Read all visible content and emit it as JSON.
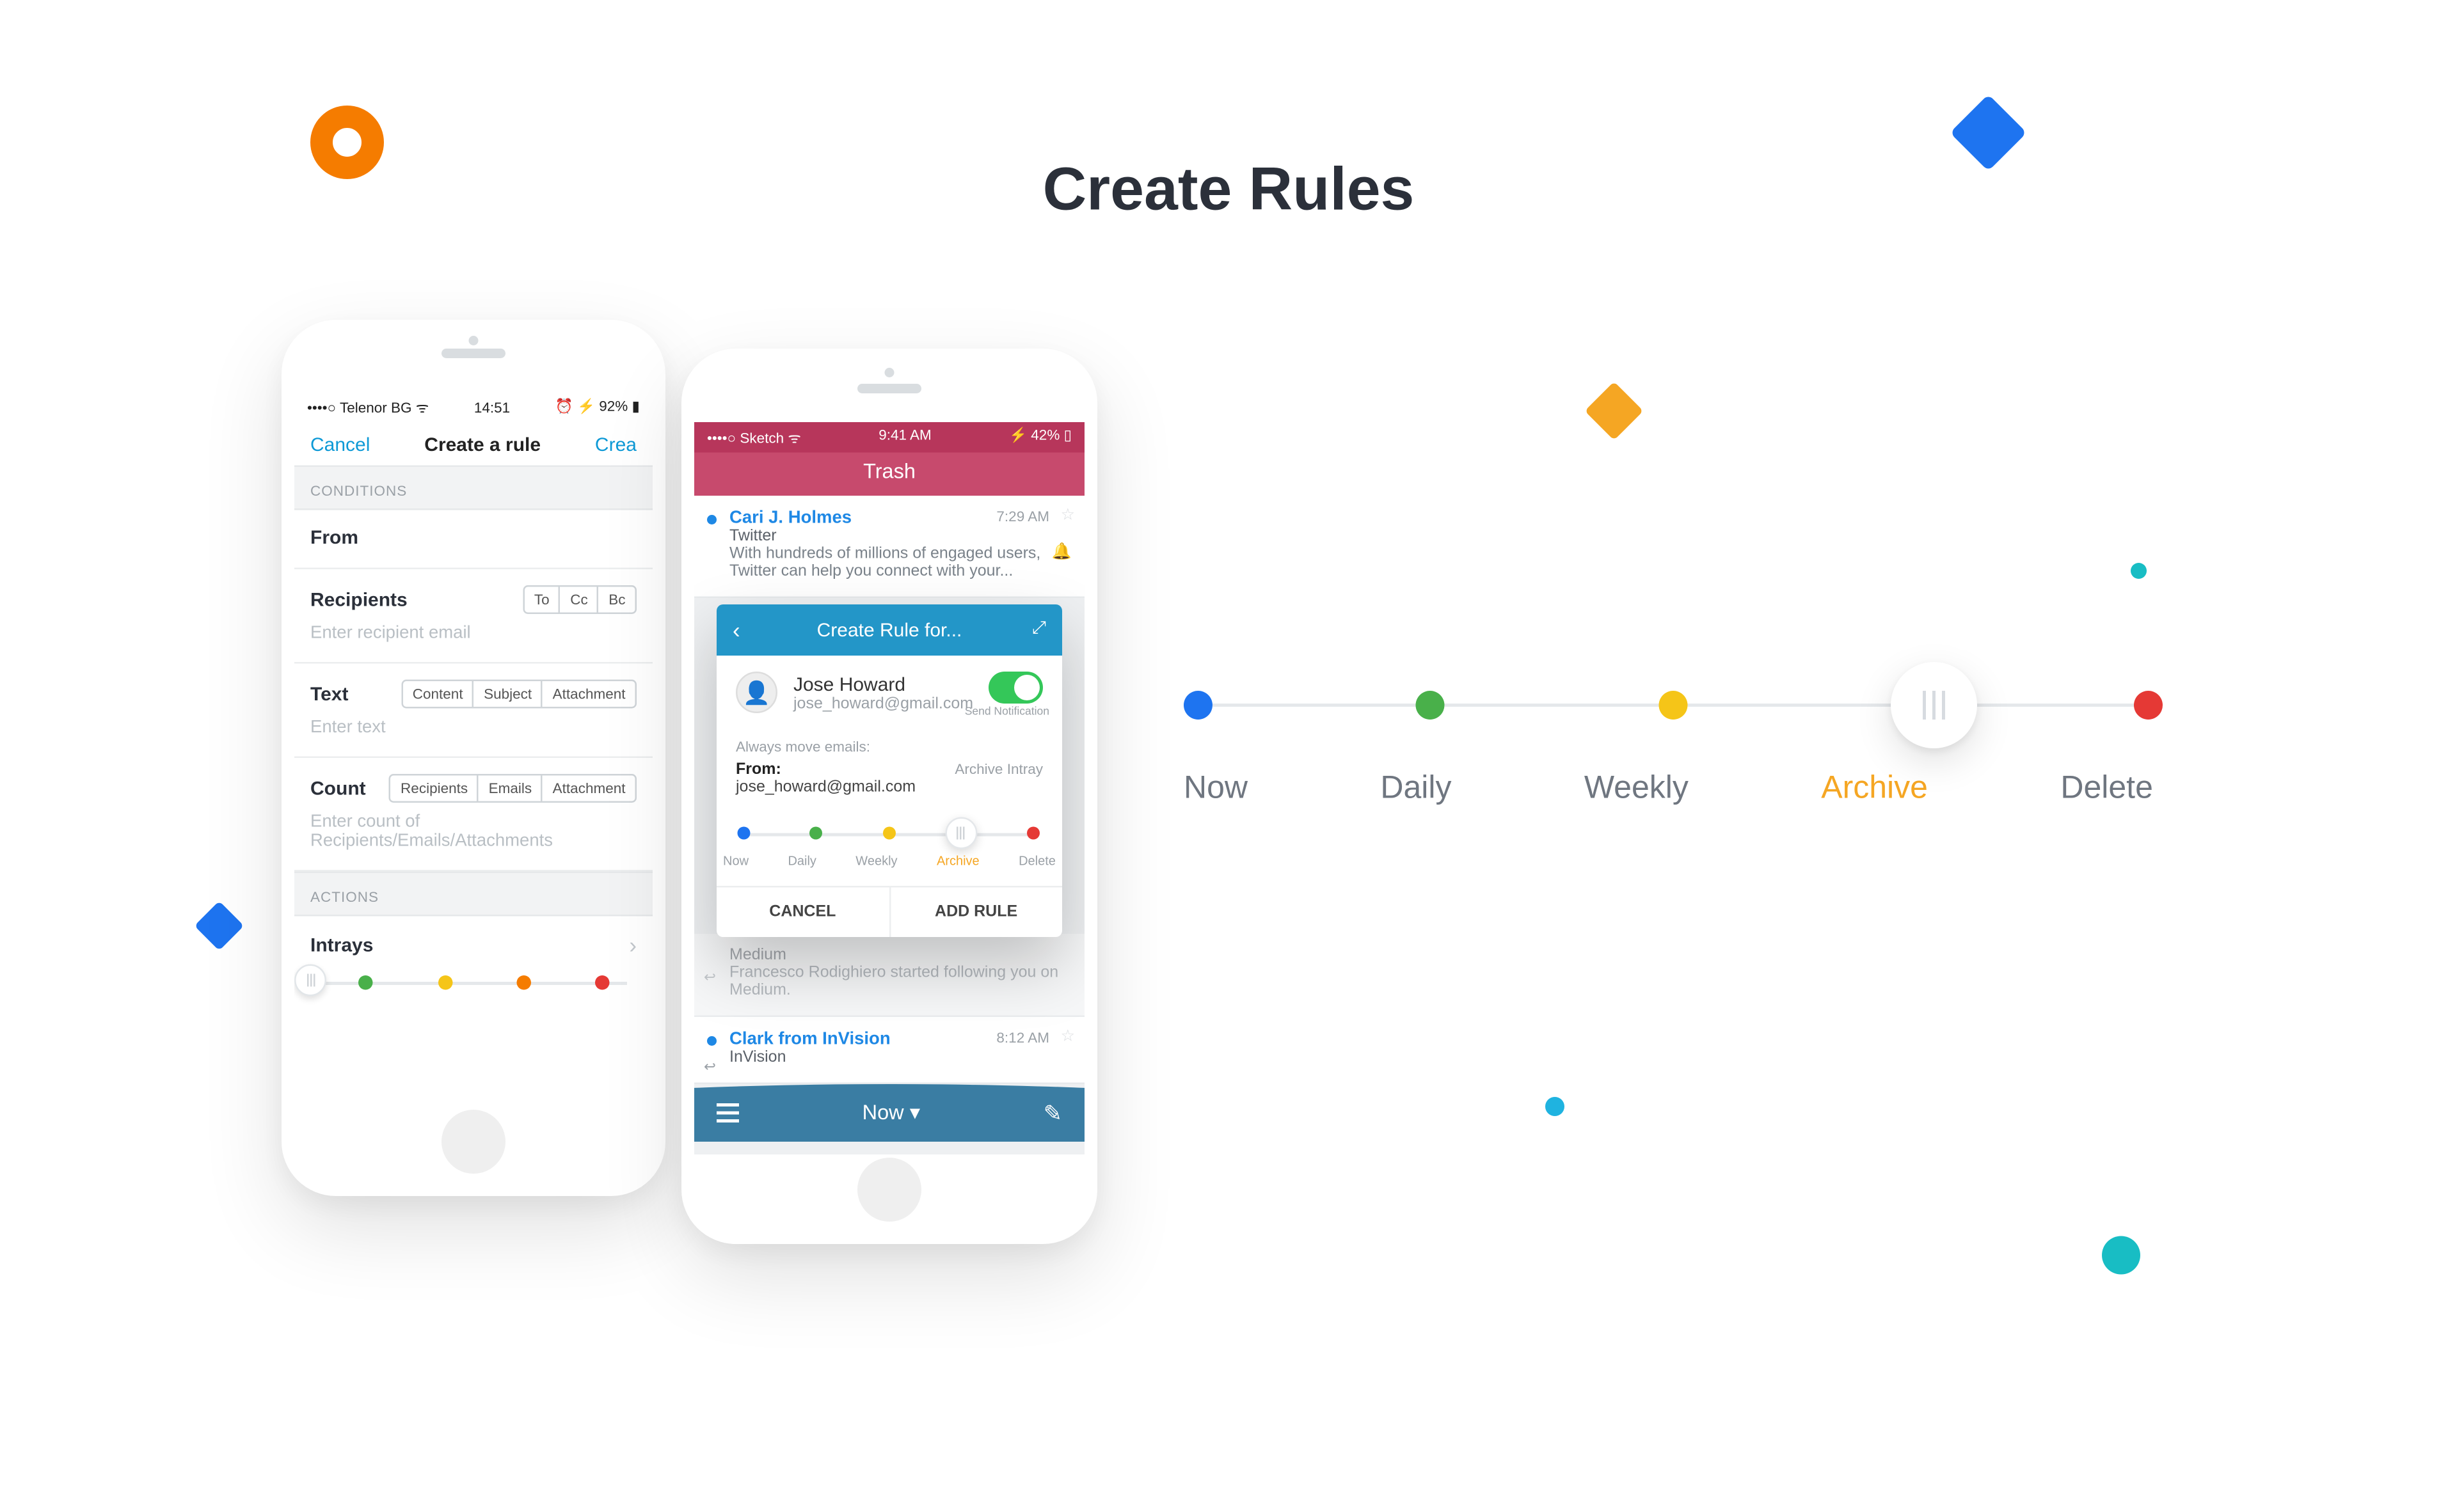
{
  "title": "Create Rules",
  "phone1": {
    "status": {
      "carrier": "••••○ Telenor BG ᯤ",
      "time": "14:51",
      "right": "⏰ ⚡ 92% ▮"
    },
    "nav": {
      "cancel": "Cancel",
      "title": "Create a rule",
      "create": "Crea"
    },
    "sections": {
      "conditions": "CONDITIONS",
      "actions": "ACTIONS"
    },
    "fields": {
      "from": {
        "label": "From"
      },
      "recipients": {
        "label": "Recipients",
        "segs": [
          "To",
          "Cc",
          "Bc"
        ],
        "placeholder": "Enter recipient email"
      },
      "text": {
        "label": "Text",
        "segs": [
          "Content",
          "Subject",
          "Attachment"
        ],
        "placeholder": "Enter text"
      },
      "count": {
        "label": "Count",
        "segs": [
          "Recipients",
          "Emails",
          "Attachment"
        ],
        "placeholder": "Enter count of Recipients/Emails/Attachments"
      },
      "intrays": {
        "label": "Intrays"
      }
    }
  },
  "phone2": {
    "status": {
      "left": "••••○ Sketch ᯤ",
      "time": "9:41 AM",
      "right": "⚡ 42% ▯"
    },
    "title": "Trash",
    "emails": [
      {
        "sender": "Cari J. Holmes",
        "subject": "Twitter",
        "preview": "With hundreds of millions of engaged users, Twitter can help you connect with your...",
        "time": "7:29  AM",
        "unread": true,
        "bell": true
      },
      {
        "sender": "",
        "subject": "Medium",
        "preview": "Francesco Rodighiero started following you on Medium.",
        "time": "",
        "unread": false,
        "reply": true
      },
      {
        "sender": "Clark from InVision",
        "subject": "InVision",
        "preview": "",
        "time": "8:12  AM",
        "unread": true,
        "reply": true
      }
    ],
    "bottombar": {
      "label": "Now"
    },
    "modal": {
      "title": "Create Rule for...",
      "user": {
        "name": "Jose Howard",
        "email": "jose_howard@gmail.com"
      },
      "toggleCaption": "Send Notification",
      "sectionLabel": "Always move emails:",
      "archiveLink": "Archive Intray",
      "fromPrefix": "From:",
      "fromValue": "jose_howard@gmail.com",
      "sliderLabels": [
        "Now",
        "Daily",
        "Weekly",
        "Archive",
        "Delete"
      ],
      "cancel": "CANCEL",
      "addRule": "ADD RULE"
    }
  },
  "bigSlider": {
    "labels": [
      "Now",
      "Daily",
      "Weekly",
      "Archive",
      "Delete"
    ]
  }
}
